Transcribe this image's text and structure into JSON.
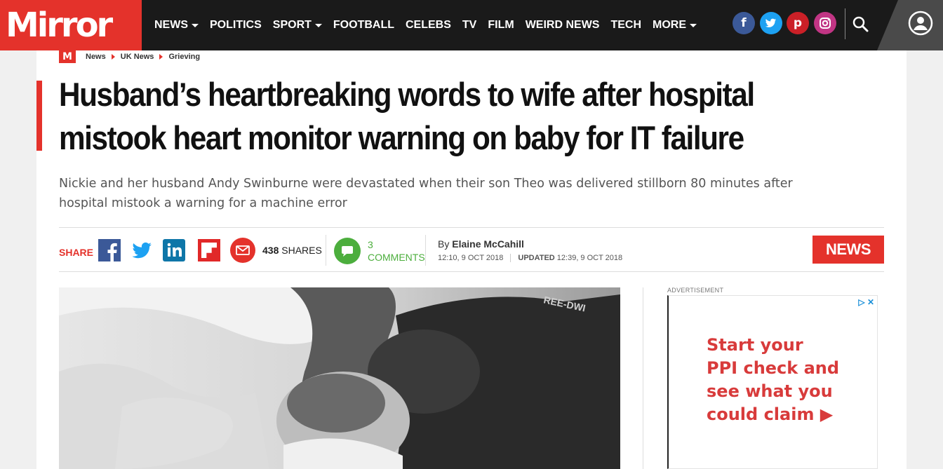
{
  "header": {
    "logo": "Mirror",
    "nav": [
      {
        "label": "NEWS",
        "dropdown": true
      },
      {
        "label": "POLITICS",
        "dropdown": false
      },
      {
        "label": "SPORT",
        "dropdown": true
      },
      {
        "label": "FOOTBALL",
        "dropdown": false
      },
      {
        "label": "CELEBS",
        "dropdown": false
      },
      {
        "label": "TV",
        "dropdown": false
      },
      {
        "label": "FILM",
        "dropdown": false
      },
      {
        "label": "WEIRD NEWS",
        "dropdown": false
      },
      {
        "label": "TECH",
        "dropdown": false
      },
      {
        "label": "MORE",
        "dropdown": true
      }
    ],
    "social": [
      {
        "name": "facebook-icon",
        "glyph": "f",
        "color": "#3b5998"
      },
      {
        "name": "twitter-icon",
        "glyph": "t",
        "color": "#1da1f2"
      },
      {
        "name": "pinterest-icon",
        "glyph": "p",
        "color": "#cb2027"
      },
      {
        "name": "instagram-icon",
        "glyph": "◎",
        "color": "#c13584"
      }
    ]
  },
  "breadcrumb": {
    "logo": "M",
    "items": [
      "News",
      "UK News",
      "Grieving"
    ]
  },
  "article": {
    "headline_line1": "Husband’s heartbreaking words to wife after hospital",
    "headline_line2": "mistook heart monitor warning on baby for IT failure",
    "standfirst_line1": "Nickie and her husband Andy Swinburne were devastated when their son Theo was delivered stillborn 80 minutes after",
    "standfirst_line2": "hospital mistook a warning for a machine error",
    "share_label": "SHARE",
    "shares_count": "438",
    "shares_label": "SHARES",
    "comments_count": "3",
    "comments_label": "COMMENTS",
    "by_label": "By",
    "author": "Elaine McCahill",
    "published": "12:10, 9 OCT 2018",
    "updated_label": "UPDATED",
    "updated": "12:39, 9 OCT 2018",
    "section_badge": "NEWS"
  },
  "ad": {
    "label": "ADVERTISEMENT",
    "choices": "▷ ✕",
    "line1": "Start your",
    "line2": "PPI check and",
    "line3": "see what you",
    "line4": "could claim ▶"
  },
  "colors": {
    "brand": "#e4322b",
    "nav_bg": "#1a1a1a",
    "comments": "#4cae3d"
  }
}
